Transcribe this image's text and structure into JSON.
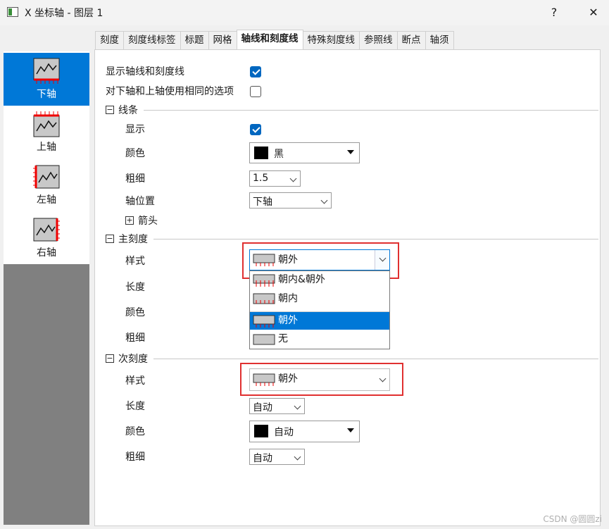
{
  "window": {
    "title": "X 坐标轴 - 图层 1",
    "help": "?",
    "close": "✕"
  },
  "tabs": [
    "刻度",
    "刻度线标签",
    "标题",
    "网格",
    "轴线和刻度线",
    "特殊刻度线",
    "参照线",
    "断点",
    "轴须"
  ],
  "active_tab": "轴线和刻度线",
  "sidebar": {
    "items": [
      "下轴",
      "上轴",
      "左轴",
      "右轴"
    ],
    "selected": "下轴"
  },
  "options": {
    "show_axis_label": "显示轴线和刻度线",
    "same_options_label": "对下轴和上轴使用相同的选项"
  },
  "line": {
    "header": "线条",
    "show_label": "显示",
    "color_label": "颜色",
    "color_value": "黑",
    "width_label": "粗细",
    "width_value": "1.5",
    "position_label": "轴位置",
    "position_value": "下轴",
    "arrow_label": "箭头"
  },
  "major": {
    "header": "主刻度",
    "style_label": "样式",
    "style_value": "朝外",
    "length_label": "长度",
    "color_label": "颜色",
    "width_label": "粗细",
    "dropdown_options": [
      "朝内&朝外",
      "朝内",
      "朝外",
      "无"
    ],
    "dropdown_selected": "朝外"
  },
  "minor": {
    "header": "次刻度",
    "style_label": "样式",
    "style_value": "朝外",
    "length_label": "长度",
    "length_value": "自动",
    "color_label": "颜色",
    "color_value": "自动",
    "width_label": "粗细",
    "width_value": "自动"
  },
  "colors": {
    "accent": "#0078d7",
    "highlight_box": "#e03030",
    "sidebar_gray": "#808080"
  },
  "watermark": "CSDN @圆圆zi"
}
